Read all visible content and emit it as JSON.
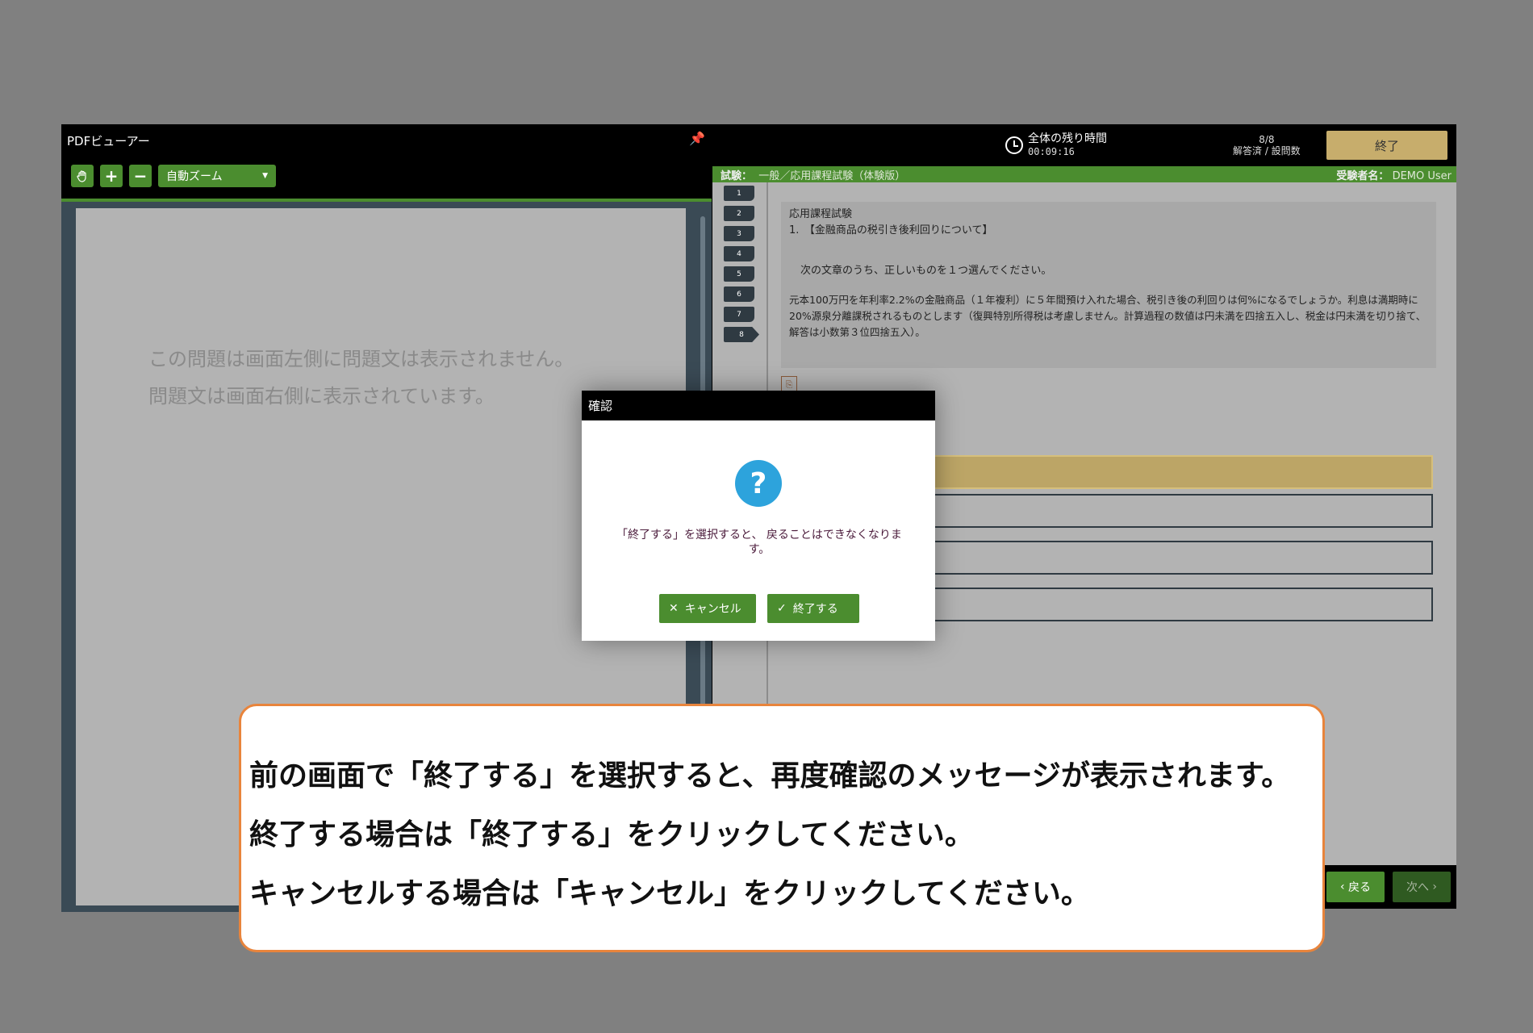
{
  "pdf_viewer": {
    "title": "PDFビューアー",
    "zoom_value": "自動ズーム",
    "message_line1": "この問題は画面左側に問題文は表示されません。",
    "message_line2": "問題文は画面右側に表示されています。"
  },
  "header": {
    "timer_label": "全体の残り時間",
    "timer_value": "00:09:16",
    "progress_count": "8/8",
    "progress_label": "解答済 / 設問数",
    "finish_label": "終了"
  },
  "exam_bar": {
    "exam_label": "試験：",
    "exam_name": "一般／応用課程試験（体験版）",
    "examinee_label": "受験者名：",
    "examinee_name": "DEMO User"
  },
  "question_tabs": [
    "1",
    "2",
    "3",
    "4",
    "5",
    "6",
    "7",
    "8"
  ],
  "question": {
    "course": "応用課程試験",
    "heading": "1.　【金融商品の税引き後利回りについて】",
    "instruction": "次の文章のうち、正しいものを１つ選んでください。",
    "body": "元本100万円を年利率2.2%の金融商品（１年複利）に５年間預け入れた場合、税引き後の利回りは何%になるでしょうか。利息は満期時に20%源泉分離課税されるものとします（復興特別所得税は考慮しません。計算過程の数値は円未満を四捨五入し、税金は円未満を切り捨て、解答は小数第３位四捨五入）。"
  },
  "nav": {
    "back_label": "戻る",
    "next_label": "次へ"
  },
  "dialog": {
    "title": "確認",
    "message": "「終了する」を選択すると、 戻ることはできなくなります。",
    "cancel_label": "キャンセル",
    "ok_label": "終了する"
  },
  "callout": {
    "line1": "前の画面で「終了する」を選択すると、再度確認のメッセージが表示されます。",
    "line2": "終了する場合は「終了する」をクリックしてください。",
    "line3": "キャンセルする場合は「キャンセル」をクリックしてください。"
  }
}
